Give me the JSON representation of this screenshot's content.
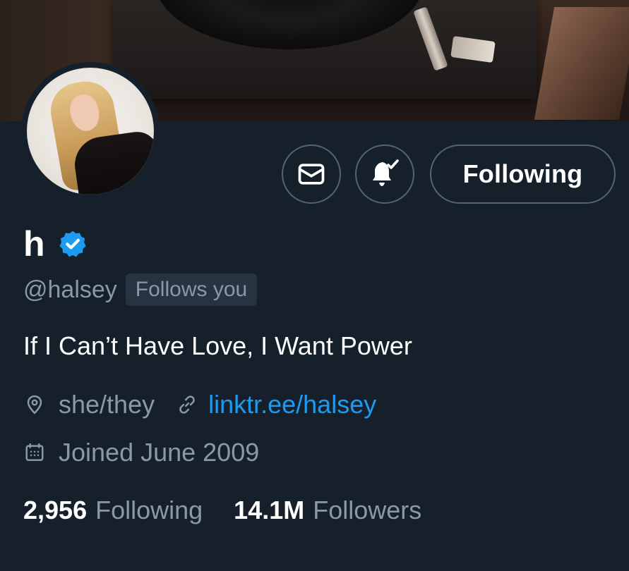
{
  "profile": {
    "display_name": "h",
    "handle": "@halsey",
    "follows_you_label": "Follows you",
    "bio": "If I Can’t Have Love, I Want Power",
    "location": "she/they",
    "website": "linktr.ee/halsey",
    "joined": "Joined June 2009",
    "verified": true
  },
  "actions": {
    "message_icon": "envelope-icon",
    "notifications_icon": "bell-subscribed-icon",
    "follow_button_label": "Following"
  },
  "stats": {
    "following_count": "2,956",
    "following_label": "Following",
    "followers_count": "14.1M",
    "followers_label": "Followers"
  },
  "icons": {
    "location": "location-pin-icon",
    "website": "link-icon",
    "joined": "calendar-icon",
    "verified": "verified-badge-icon"
  },
  "colors": {
    "background": "#15202b",
    "accent": "#1d9bf0",
    "secondary_text": "#8b98a5",
    "button_border": "#536471"
  }
}
